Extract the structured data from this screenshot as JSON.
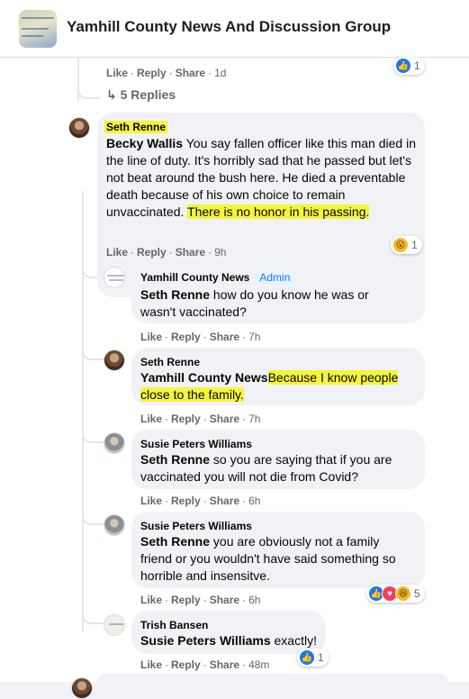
{
  "group": {
    "title": "Yamhill County News And Discussion Group",
    "avatar_icon": "group-cover-image"
  },
  "actions": {
    "like": "Like",
    "reply": "Reply",
    "share": "Share",
    "separator": "·"
  },
  "top_comment": {
    "time": "1d",
    "reaction_count": "1",
    "replies_label": "5 Replies"
  },
  "comments": [
    {
      "author": "Seth Renne",
      "mention": "Becky Wallis",
      "text": " You say fallen officer like this man died in the line of duty. It's horribly sad that he passed but let's not beat around the bush here. He died a preventable death because of his own choice to remain unvaccinated. ",
      "highlighted_text": "There is no honor in his passing.",
      "time": "9h",
      "reaction_count": "1",
      "reaction_icons": [
        "wow-icon"
      ]
    },
    {
      "author": "Yamhill County News",
      "badge": "Admin",
      "mention": "Seth Renne",
      "text": " how do you know he was or wasn't vaccinated?",
      "time": "7h"
    },
    {
      "author": "Seth Renne",
      "mention": "Yamhill County News",
      "highlighted_text": "Because I know people close to the family.",
      "time": "7h"
    },
    {
      "author": "Susie Peters Williams",
      "mention": "Seth Renne",
      "text": " so you are saying that if you are vaccinated you will not die from Covid?",
      "time": "6h"
    },
    {
      "author": "Susie Peters Williams",
      "mention": "Seth Renne",
      "text": " you are obviously not a family friend or you wouldn't have said something so horrible and insensitve.",
      "time": "6h",
      "reaction_count": "5",
      "reaction_icons": [
        "like-icon",
        "love-icon",
        "haha-icon"
      ]
    },
    {
      "author": "Trish Bansen",
      "mention": "Susie Peters Williams",
      "text": " exactly!",
      "time": "48m",
      "reaction_count": "1",
      "reaction_icons": [
        "like-icon"
      ]
    }
  ],
  "colors": {
    "highlight": "#f5f53a",
    "link_blue": "#1877f2",
    "bubble": "#f0f2f5",
    "secondary_text": "#65676b"
  }
}
